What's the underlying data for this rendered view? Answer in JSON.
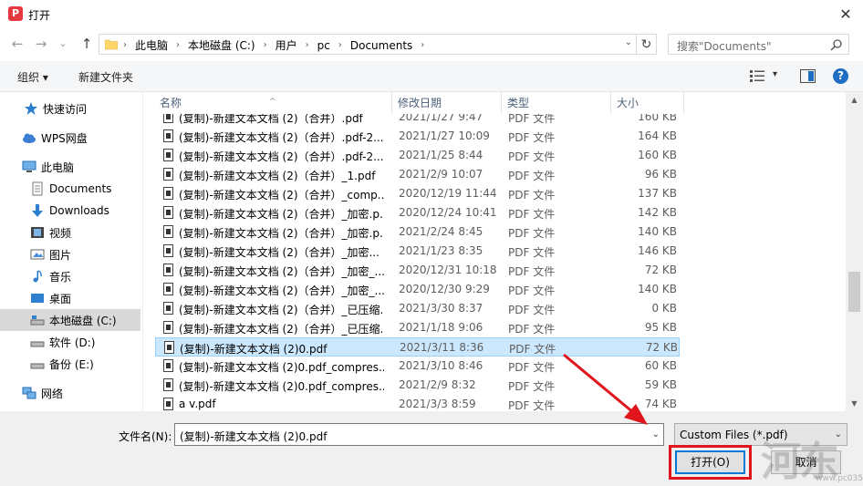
{
  "window": {
    "title": "打开",
    "app_icon_letter": "P",
    "close_glyph": "✕"
  },
  "nav_buttons": {
    "back": "←",
    "forward": "→",
    "recent": "⌄",
    "up": "↑"
  },
  "address": {
    "crumbs": [
      "此电脑",
      "本地磁盘 (C:)",
      "用户",
      "pc",
      "Documents"
    ],
    "separator": "›",
    "dropdown": "⌄",
    "refresh": "↻"
  },
  "search": {
    "placeholder": "搜索\"Documents\""
  },
  "toolbar": {
    "organize": "组织 ▾",
    "new_folder": "新建文件夹",
    "view_dropdown": "▾",
    "help": "?"
  },
  "nav_pane": {
    "items": [
      {
        "label": "快速访问",
        "icon": "star-icon"
      },
      {
        "label": "WPS网盘",
        "icon": "cloud-icon"
      },
      {
        "label": "此电脑",
        "icon": "computer-icon"
      },
      {
        "label": "Documents",
        "icon": "document-icon"
      },
      {
        "label": "Downloads",
        "icon": "download-icon"
      },
      {
        "label": "视频",
        "icon": "video-icon"
      },
      {
        "label": "图片",
        "icon": "picture-icon"
      },
      {
        "label": "音乐",
        "icon": "music-icon"
      },
      {
        "label": "桌面",
        "icon": "desktop-icon"
      },
      {
        "label": "本地磁盘 (C:)",
        "icon": "drive-icon"
      },
      {
        "label": "软件 (D:)",
        "icon": "drive-icon"
      },
      {
        "label": "备份 (E:)",
        "icon": "drive-icon"
      },
      {
        "label": "网络",
        "icon": "network-icon"
      }
    ],
    "selected": "本地磁盘 (C:)"
  },
  "file_list": {
    "columns": [
      "名称",
      "修改日期",
      "类型",
      "大小"
    ],
    "sort_indicator": "^",
    "rows": [
      {
        "name": "(复制)-新建文本文档 (2)（合并）.pdf",
        "date": "2021/1/27 9:47",
        "type": "PDF 文件",
        "size": "160 KB"
      },
      {
        "name": "(复制)-新建文本文档 (2)（合并）.pdf-2...",
        "date": "2021/1/27 10:09",
        "type": "PDF 文件",
        "size": "164 KB"
      },
      {
        "name": "(复制)-新建文本文档 (2)（合并）.pdf-2...",
        "date": "2021/1/25 8:44",
        "type": "PDF 文件",
        "size": "160 KB"
      },
      {
        "name": "(复制)-新建文本文档 (2)（合并）_1.pdf",
        "date": "2021/2/9 10:07",
        "type": "PDF 文件",
        "size": "96 KB"
      },
      {
        "name": "(复制)-新建文本文档 (2)（合并）_comp...",
        "date": "2020/12/19 11:44",
        "type": "PDF 文件",
        "size": "137 KB"
      },
      {
        "name": "(复制)-新建文本文档 (2)（合并）_加密.p...",
        "date": "2020/12/24 10:41",
        "type": "PDF 文件",
        "size": "142 KB"
      },
      {
        "name": "(复制)-新建文本文档 (2)（合并）_加密.p...",
        "date": "2021/2/24 8:45",
        "type": "PDF 文件",
        "size": "140 KB"
      },
      {
        "name": "(复制)-新建文本文档 (2)（合并）_加密...",
        "date": "2021/1/23 8:35",
        "type": "PDF 文件",
        "size": "146 KB"
      },
      {
        "name": "(复制)-新建文本文档 (2)（合并）_加密_...",
        "date": "2020/12/31 10:18",
        "type": "PDF 文件",
        "size": "72 KB"
      },
      {
        "name": "(复制)-新建文本文档 (2)（合并）_加密_...",
        "date": "2020/12/30 9:29",
        "type": "PDF 文件",
        "size": "140 KB"
      },
      {
        "name": "(复制)-新建文本文档 (2)（合并）_已压缩...",
        "date": "2021/3/30 8:37",
        "type": "PDF 文件",
        "size": "0 KB"
      },
      {
        "name": "(复制)-新建文本文档 (2)（合并）_已压缩...",
        "date": "2021/1/18 9:06",
        "type": "PDF 文件",
        "size": "95 KB"
      },
      {
        "name": "(复制)-新建文本文档 (2)0.pdf",
        "date": "2021/3/11 8:36",
        "type": "PDF 文件",
        "size": "72 KB"
      },
      {
        "name": "(复制)-新建文本文档 (2)0.pdf_compres...",
        "date": "2021/3/10 8:46",
        "type": "PDF 文件",
        "size": "60 KB"
      },
      {
        "name": "(复制)-新建文本文档 (2)0.pdf_compres...",
        "date": "2021/2/9 8:32",
        "type": "PDF 文件",
        "size": "59 KB"
      },
      {
        "name": "a v.pdf",
        "date": "2021/3/3 8:59",
        "type": "PDF 文件",
        "size": "74 KB"
      }
    ],
    "selected_name": "(复制)-新建文本文档 (2)0.pdf"
  },
  "scrollbar": {
    "up": "▲",
    "down": "▼"
  },
  "bottom": {
    "filename_label": "文件名(N):",
    "filename_value": "(复制)-新建文本文档 (2)0.pdf",
    "filetype_value": "Custom Files (*.pdf)",
    "dropdown": "⌄",
    "open_label": "打开(O)",
    "cancel_label": "取消"
  },
  "annotation": {
    "highlight_color": "#e0161c"
  },
  "watermark": {
    "text": "河东",
    "url": "www.pc0359.cn"
  },
  "colors": {
    "accent": "#0078d7",
    "selection_bg": "#cce8ff",
    "header_text": "#4c607a",
    "help_blue": "#1f6ec3",
    "annotation_red": "#e0161c"
  }
}
